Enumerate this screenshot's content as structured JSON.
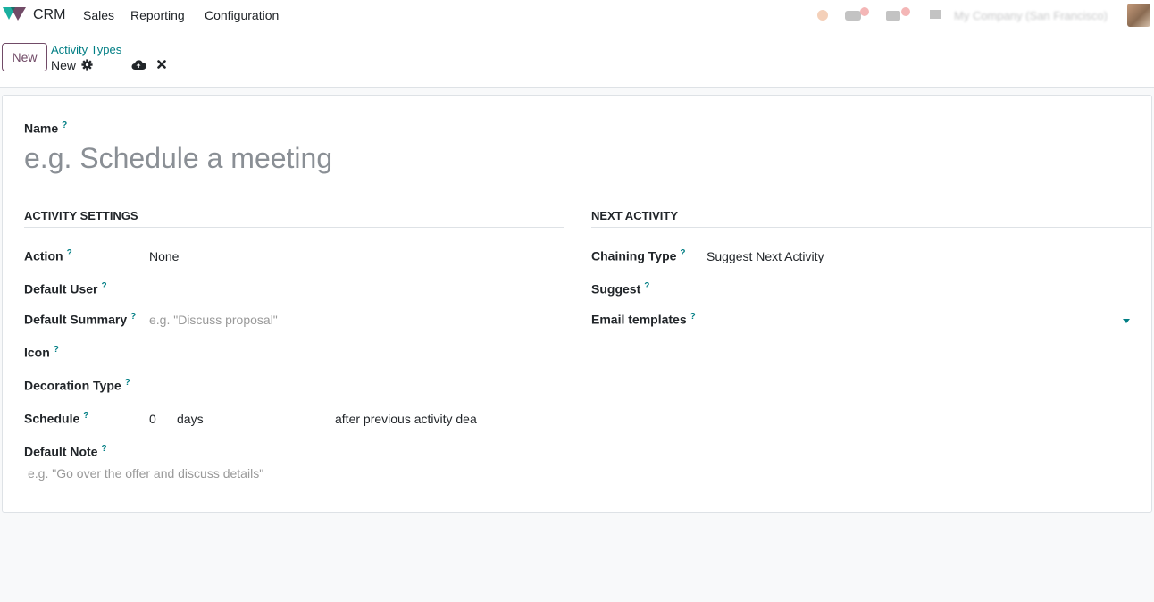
{
  "navbar": {
    "app_name": "CRM",
    "menu": [
      "Sales",
      "Reporting",
      "Configuration"
    ],
    "company": "My Company (San Francisco)"
  },
  "control_panel": {
    "new_label": "New",
    "breadcrumb": "Activity Types",
    "record_label": "New"
  },
  "form": {
    "name_label": "Name",
    "name_placeholder": "e.g. Schedule a meeting",
    "activity_settings": {
      "title": "ACTIVITY SETTINGS",
      "action_label": "Action",
      "action_value": "None",
      "default_user_label": "Default User",
      "default_summary_label": "Default Summary",
      "default_summary_placeholder": "e.g. \"Discuss proposal\"",
      "icon_label": "Icon",
      "decoration_type_label": "Decoration Type",
      "schedule_label": "Schedule",
      "schedule_value": "0",
      "schedule_unit": "days",
      "schedule_from": "after previous activity dea",
      "default_note_label": "Default Note",
      "default_note_placeholder": "e.g. \"Go over the offer and discuss details\""
    },
    "next_activity": {
      "title": "NEXT ACTIVITY",
      "chaining_type_label": "Chaining Type",
      "chaining_type_value": "Suggest Next Activity",
      "suggest_label": "Suggest",
      "email_templates_label": "Email templates"
    },
    "help_mark": "?"
  },
  "colors": {
    "brand": "#714B67",
    "accent": "#017e84"
  },
  "icons": [
    "crm-logo-icon",
    "gear-icon",
    "cloud-upload-icon",
    "close-icon",
    "chat-icon",
    "activity-icon",
    "debug-icon"
  ]
}
